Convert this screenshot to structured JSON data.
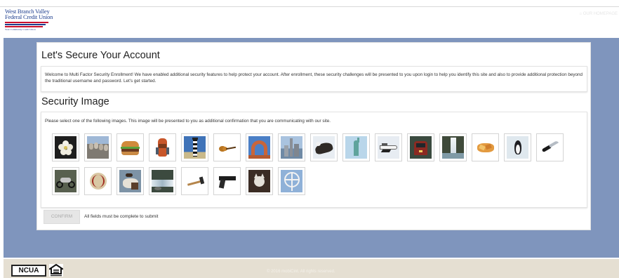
{
  "header": {
    "logo": {
      "line1": "West Branch Valley",
      "line2": "Federal Credit Union",
      "tagline": "Your Community Credit Union"
    },
    "homepage_link": "OUR HOMEPAGE"
  },
  "page": {
    "title": "Let's Secure Your Account",
    "intro": "Welcome to Multi Factor Security Enrollment! We have enabled additional security features to help protect your account. After enrollment, these security challenges will be presented to you upon login to help you identify this site and also to provide additional protection beyond the traditional username and password. Let's get started.",
    "security_image": {
      "title": "Security Image",
      "instructions": "Please select one of the following images. This image will be presented to you as additional confirmation that you are communicating with our site.",
      "images": [
        "flower",
        "mount-rushmore",
        "hamburger",
        "backpack",
        "lighthouse",
        "guitar",
        "rock-arch",
        "city-skyline",
        "eagle",
        "statue-of-liberty",
        "space-shuttle",
        "train",
        "waterfall",
        "tortilla-chips",
        "penguin",
        "knife",
        "motorcycle",
        "baseball",
        "cowboy",
        "river-rapids",
        "hammer",
        "pistol",
        "cat",
        "ferris-wheel"
      ]
    },
    "confirm_label": "CONFIRM",
    "form_note": "All fields must be complete to submit"
  },
  "footer": {
    "ncua": "NCUA",
    "copyright": "© 2016 mobiCint. All rights reserved."
  },
  "colors": {
    "band": "#7f95bd",
    "footer_bg": "#e5dfd2",
    "logo_blue": "#1f3f8f"
  }
}
